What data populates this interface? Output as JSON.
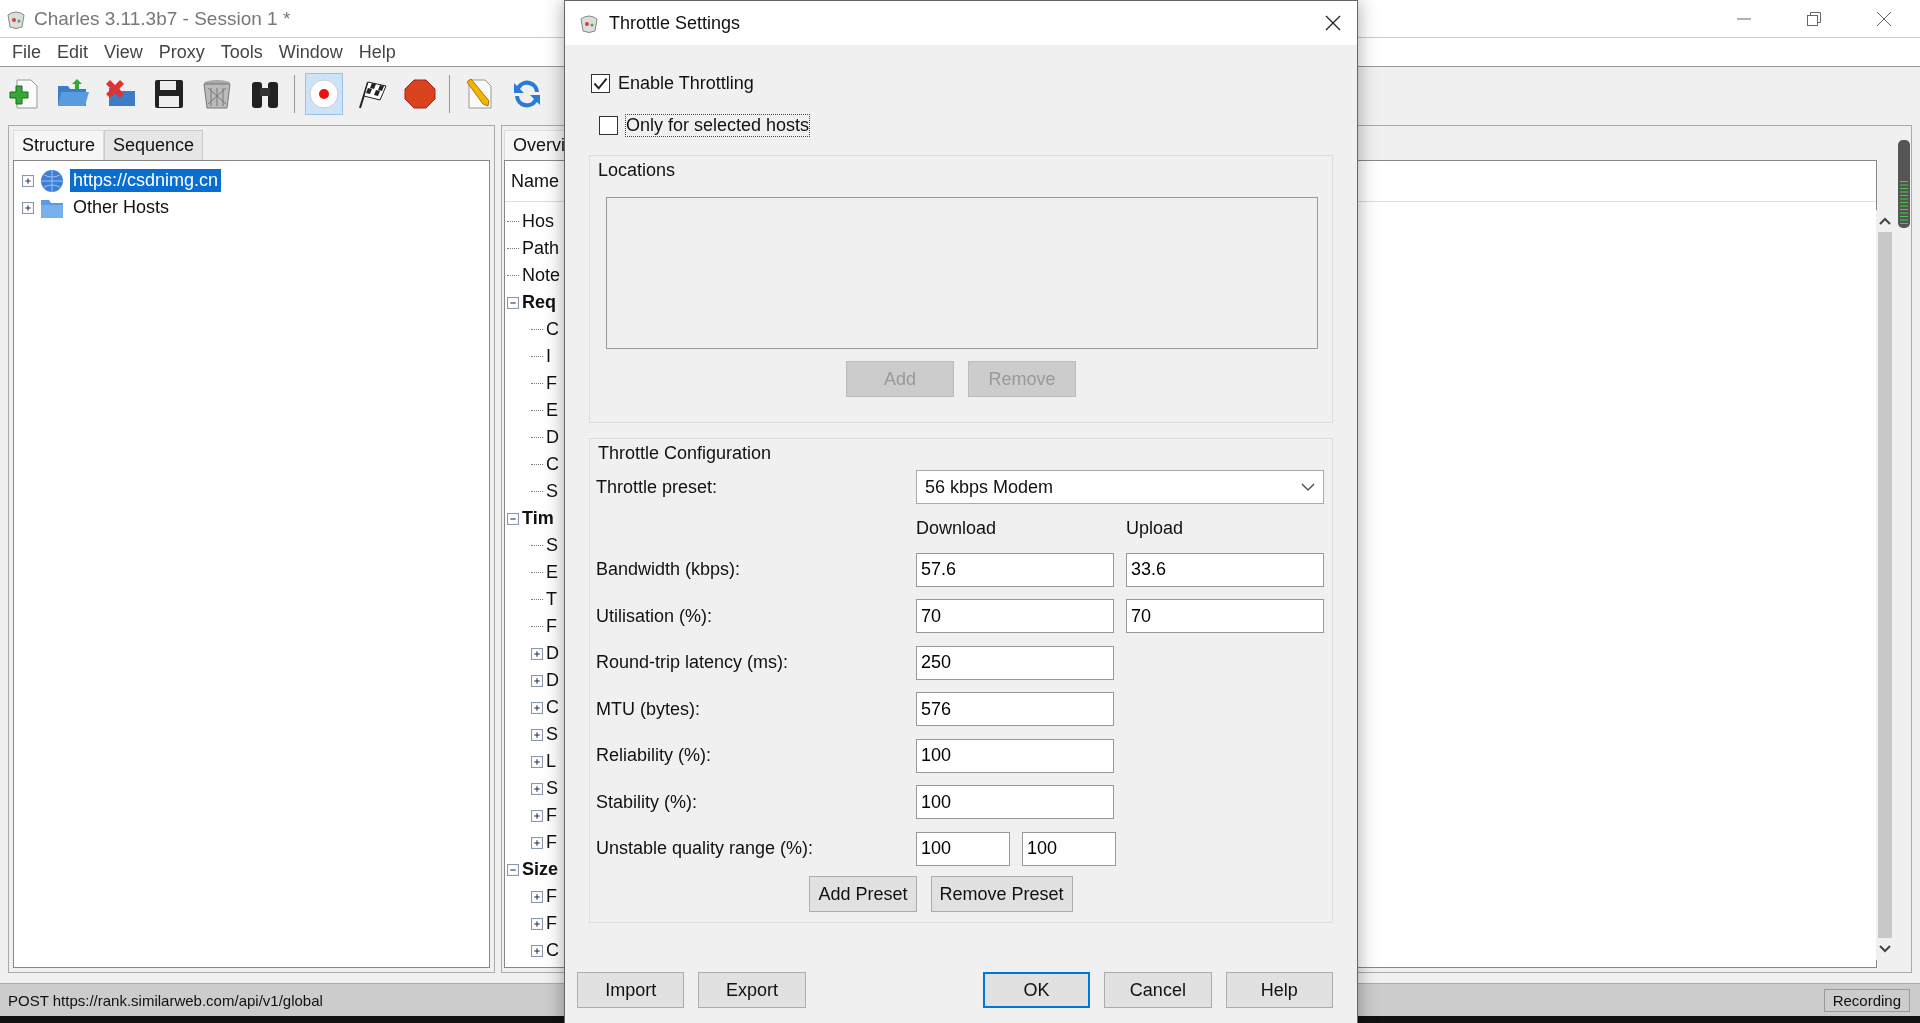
{
  "window": {
    "title": "Charles 3.11.3b7 - Session 1 *"
  },
  "menu": [
    "File",
    "Edit",
    "View",
    "Proxy",
    "Tools",
    "Window",
    "Help"
  ],
  "toolbar": [
    {
      "kind": "new",
      "on": false
    },
    {
      "kind": "open",
      "on": false
    },
    {
      "kind": "close",
      "on": false
    },
    {
      "kind": "save",
      "on": false
    },
    {
      "kind": "clear",
      "on": false
    },
    {
      "kind": "find",
      "on": false
    },
    {
      "kind": "record",
      "on": true
    },
    {
      "kind": "flag",
      "on": false
    },
    {
      "kind": "stop",
      "on": false
    },
    {
      "kind": "edit",
      "on": false
    },
    {
      "kind": "repeat",
      "on": false
    }
  ],
  "left_panel": {
    "tabs": [
      {
        "label": "Structure",
        "selected": true
      },
      {
        "label": "Sequence",
        "selected": false
      }
    ],
    "tree": [
      {
        "label": "https://csdnimg.cn",
        "kind": "host",
        "selected": true
      },
      {
        "label": "Other Hosts",
        "kind": "folder",
        "selected": false
      }
    ]
  },
  "middle_panel": {
    "tab": "Overvi",
    "header": "Name",
    "tree": [
      {
        "label": "Hos",
        "kind": "leaf"
      },
      {
        "label": "Path",
        "kind": "leaf"
      },
      {
        "label": "Note",
        "kind": "leaf"
      },
      {
        "label": "Req",
        "kind": "section",
        "expanded": true,
        "children": [
          {
            "label": "C",
            "kind": "leaf"
          },
          {
            "label": "I",
            "kind": "leaf"
          },
          {
            "label": "F",
            "kind": "leaf"
          },
          {
            "label": "E",
            "kind": "leaf"
          },
          {
            "label": "D",
            "kind": "leaf"
          },
          {
            "label": "C",
            "kind": "leaf"
          },
          {
            "label": "S",
            "kind": "leaf"
          }
        ]
      },
      {
        "label": "Tim",
        "kind": "section",
        "expanded": true,
        "children": [
          {
            "label": "S",
            "kind": "leaf"
          },
          {
            "label": "E",
            "kind": "leaf"
          },
          {
            "label": "T",
            "kind": "leaf"
          },
          {
            "label": "F",
            "kind": "leaf"
          },
          {
            "label": "D",
            "kind": "branch",
            "expanded": false
          },
          {
            "label": "D",
            "kind": "branch",
            "expanded": false
          },
          {
            "label": "C",
            "kind": "branch",
            "expanded": false
          },
          {
            "label": "S",
            "kind": "branch",
            "expanded": false
          },
          {
            "label": "L",
            "kind": "branch",
            "expanded": false
          },
          {
            "label": "S",
            "kind": "branch",
            "expanded": false
          },
          {
            "label": "F",
            "kind": "branch",
            "expanded": false
          },
          {
            "label": "F",
            "kind": "branch",
            "expanded": false
          }
        ]
      },
      {
        "label": "Size",
        "kind": "section",
        "expanded": true,
        "children": [
          {
            "label": "F",
            "kind": "branch",
            "expanded": false
          },
          {
            "label": "F",
            "kind": "branch",
            "expanded": false
          },
          {
            "label": "C",
            "kind": "branch",
            "expanded": false
          }
        ]
      }
    ]
  },
  "status_bar": {
    "text": "POST https://rank.similarweb.com/api/v1/global",
    "recording": "Recording"
  },
  "dialog": {
    "title": "Throttle Settings",
    "enable_throttling": {
      "label": "Enable Throttling",
      "checked": true
    },
    "only_selected_hosts": {
      "label": "Only for selected hosts",
      "checked": false
    },
    "locations": {
      "title": "Locations",
      "buttons": [
        {
          "label": "Add",
          "disabled": true
        },
        {
          "label": "Remove",
          "disabled": true
        }
      ]
    },
    "configuration": {
      "title": "Throttle Configuration",
      "preset": {
        "label": "Throttle preset:",
        "value": "56 kbps Modem"
      },
      "columns": [
        "Download",
        "Upload"
      ],
      "rows": [
        {
          "label": "Bandwidth (kbps):",
          "values": [
            "57.6",
            "33.6"
          ]
        },
        {
          "label": "Utilisation (%):",
          "values": [
            "70",
            "70"
          ]
        },
        {
          "label": "Round-trip latency (ms):",
          "values": [
            "250"
          ]
        },
        {
          "label": "MTU (bytes):",
          "values": [
            "576"
          ]
        },
        {
          "label": "Reliability (%):",
          "values": [
            "100"
          ]
        },
        {
          "label": "Stability (%):",
          "values": [
            "100"
          ]
        },
        {
          "label": "Unstable quality range (%):",
          "kind": "range",
          "values": [
            "100",
            "100"
          ]
        }
      ],
      "buttons": [
        "Add Preset",
        "Remove Preset"
      ]
    },
    "buttons": [
      {
        "label": "Import",
        "default": false
      },
      {
        "label": "Export",
        "default": false
      },
      {
        "label": "OK",
        "default": true
      },
      {
        "label": "Cancel",
        "default": false
      },
      {
        "label": "Help",
        "default": false
      }
    ]
  }
}
